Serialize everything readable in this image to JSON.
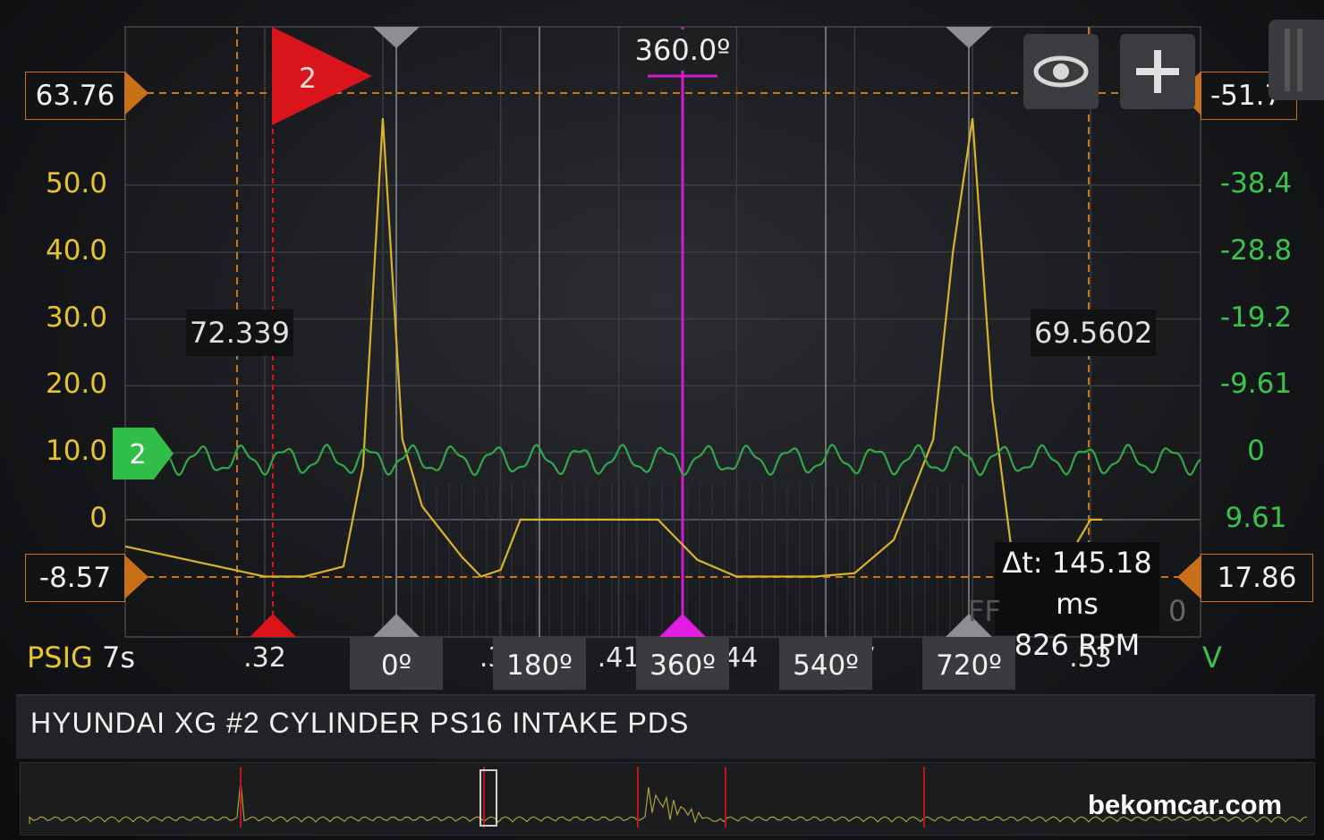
{
  "chart_data": {
    "type": "line",
    "title": "",
    "left_axis": {
      "ticks": [
        "50.0",
        "40.0",
        "30.0",
        "20.0",
        "10.0",
        "0"
      ],
      "unit": "PSIG",
      "top_value": "63.76",
      "bottom_value": "-8.57",
      "color": "#e8c32c"
    },
    "right_axis": {
      "ticks": [
        "-38.4",
        "-28.8",
        "-19.2",
        "-9.61",
        "0",
        "9.61"
      ],
      "unit": "V",
      "top_value": "-51.7",
      "bottom_value": "17.86",
      "color": "#39c24c"
    },
    "x_axis": {
      "ticks": [
        ".32",
        ".35",
        ".38",
        ".41",
        ".44",
        ".47",
        ".5",
        ".53"
      ],
      "time_base": "7s"
    },
    "degree_markers": [
      "0º",
      "180º",
      "360º",
      "540º",
      "720º"
    ],
    "cursor_degree": "360.0º",
    "series": [
      {
        "name": "PSIG",
        "color": "#e8c32c",
        "x": [
          0.32,
          0.33,
          0.34,
          0.345,
          0.35,
          0.355,
          0.36,
          0.37,
          0.375,
          0.38,
          0.385,
          0.39,
          0.4,
          0.41,
          0.42,
          0.43,
          0.44,
          0.45,
          0.46,
          0.47,
          0.48,
          0.49,
          0.495,
          0.5,
          0.505,
          0.51,
          0.52,
          0.53,
          0.533
        ],
        "values": [
          -8.5,
          -8.5,
          -7.0,
          8.0,
          60.0,
          12.0,
          2.0,
          -5.5,
          -8.5,
          -7.5,
          0.0,
          0.0,
          0.0,
          0.0,
          0.0,
          -6.0,
          -8.5,
          -8.5,
          -8.5,
          -8.0,
          -3.0,
          12.0,
          40.0,
          60.0,
          18.0,
          -5.0,
          -10.0,
          0.0,
          0.0
        ]
      },
      {
        "name": "V",
        "color": "#39c24c",
        "offset": 0,
        "amplitude": 2.4,
        "oscillating": true
      }
    ],
    "measurements": {
      "left_value": "72.339",
      "right_value": "69.5602",
      "delta_t": "Δt: 145.18 ms",
      "rpm": "826 RPM"
    },
    "channel_flag": "2",
    "channel_marker": "2"
  },
  "labels": {
    "psig": "PSIG",
    "time_base": "7s",
    "unit_v": "V",
    "title": "HYUNDAI XG #2 CYLINDER PS16 INTAKE PDS",
    "watermark": "bekomcar.com",
    "fr_hidden": "FF",
    "zero_right": "0"
  }
}
